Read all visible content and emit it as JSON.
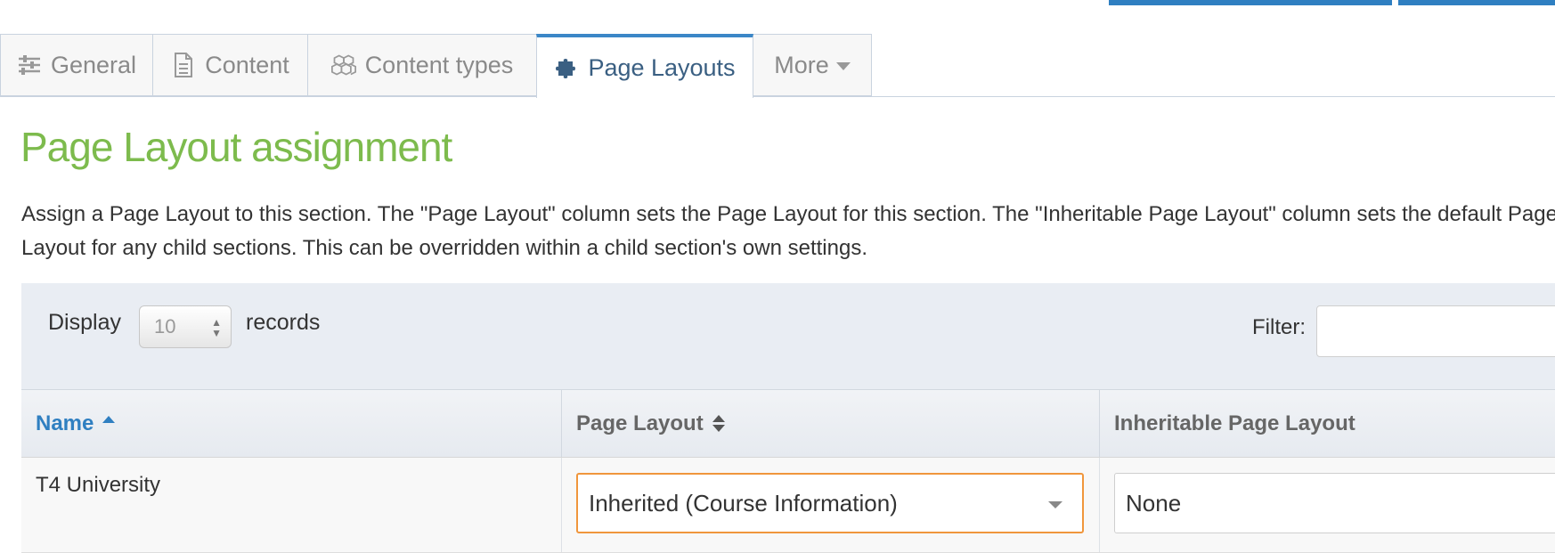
{
  "tabs": [
    {
      "label": "General",
      "icon": "sliders-icon"
    },
    {
      "label": "Content",
      "icon": "document-icon"
    },
    {
      "label": "Content types",
      "icon": "cubes-icon"
    },
    {
      "label": "Page Layouts",
      "icon": "puzzle-icon",
      "active": true
    },
    {
      "label": "More",
      "icon": "caret-down-icon"
    }
  ],
  "page": {
    "title": "Page Layout assignment",
    "description": "Assign a Page Layout to this section. The \"Page Layout\" column sets the Page Layout for this section. The \"Inheritable Page Layout\" column sets the default Page Layout for any child sections. This can be overridden within a child section's own settings."
  },
  "table_controls": {
    "display_label": "Display",
    "records_label": "records",
    "page_size": "10",
    "filter_label": "Filter:",
    "filter_value": ""
  },
  "table": {
    "columns": [
      "Name",
      "Page Layout",
      "Inheritable Page Layout"
    ],
    "rows": [
      {
        "name": "T4 University",
        "page_layout": "Inherited (Course Information)",
        "inheritable_page_layout": "None"
      }
    ]
  },
  "colors": {
    "accent": "#2f7fc1",
    "title_green": "#7dbb4d",
    "focus_orange": "#f0963c"
  }
}
